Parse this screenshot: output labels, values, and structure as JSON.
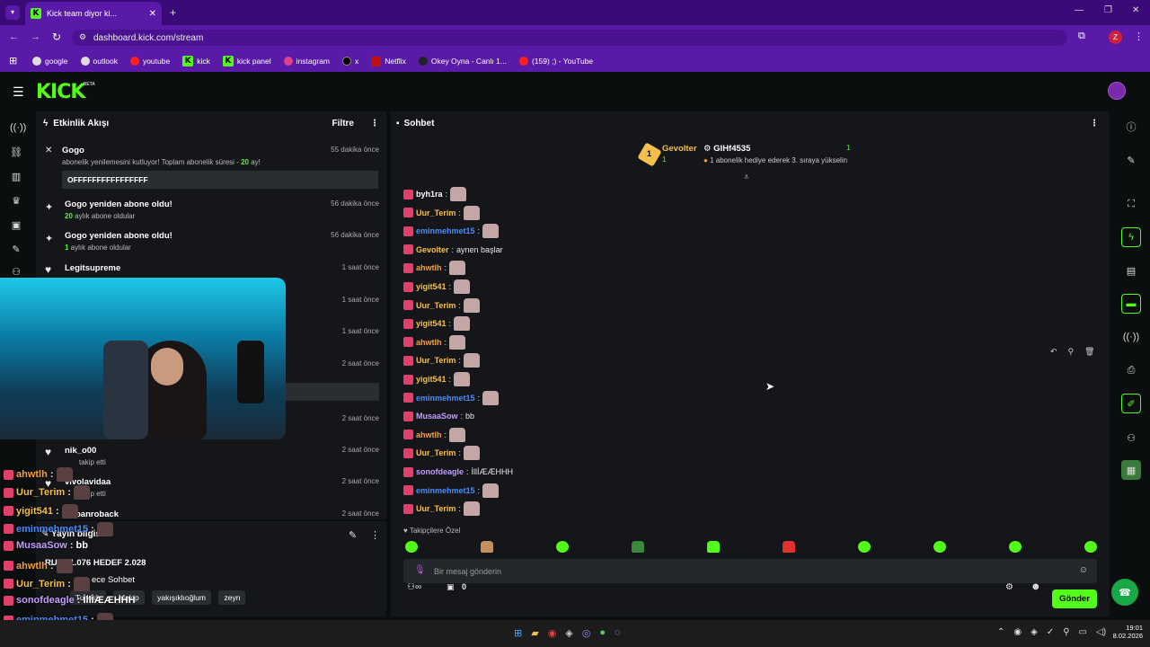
{
  "browser": {
    "tab_title": "Kick team diyor ki...",
    "url": "dashboard.kick.com/stream",
    "profile_initial": "Z",
    "bookmarks": [
      "google",
      "outlook",
      "youtube",
      "kick",
      "kick panel",
      "instagram",
      "x",
      "Netflix",
      "Okey Oyna - Canlı 1...",
      "(159) ;) - YouTube"
    ]
  },
  "header": {
    "logo": "KICK",
    "beta": "BETA"
  },
  "activity": {
    "title": "Etkinlik Akışı",
    "filter_label": "Filtre",
    "items": [
      {
        "title": "Gogo",
        "sub_pre": "abonelik yenilemesini kutluyor! Toplam abonelik süresi - ",
        "sub_num": "20",
        "sub_post": " ay!",
        "time": "55 dakika önce",
        "message": "OFFFFFFFFFFFFFFFF"
      },
      {
        "title": "Gogo yeniden abone oldu!",
        "sub_num": "20",
        "sub_post": " aylık abone oldular",
        "time": "56 dakika önce"
      },
      {
        "title": "Gogo yeniden abone oldu!",
        "sub_num": "1",
        "sub_post": " aylık abone oldular",
        "time": "56 dakika önce"
      },
      {
        "title": "Legitsupreme",
        "time": "1 saat önce"
      },
      {
        "time": "1 saat önce"
      },
      {
        "time": "1 saat önce"
      },
      {
        "time": "2 saat önce"
      },
      {
        "time": "2 saat önce"
      },
      {
        "title": "nik_o00",
        "sub_post": "takip etti",
        "time": "2 saat önce"
      },
      {
        "title": "vivolavidaa",
        "sub_post": "takip etti",
        "time": "2 saat önce"
      },
      {
        "title": "banroback",
        "time": "2 saat önce"
      }
    ]
  },
  "info_panel": {
    "title": "Yayın bilgisi",
    "stream_title": "RUM: 1.076 HEDEF 2.028",
    "mode": "ece Sohbet",
    "tags": [
      "Turkish",
      "Mekip",
      "yakışıklıoğlum",
      "zeyn"
    ]
  },
  "chat": {
    "title": "Sohbet",
    "pinned": {
      "left_user": "Gevolter",
      "left_count": "1",
      "right_user": "GIHf4535",
      "right_count": "1",
      "right_sub": "1 abonelik hediye ederek 3. sıraya yükselin"
    },
    "messages": [
      {
        "user": "byh1ra",
        "color": "#ffffff",
        "text": ""
      },
      {
        "user": "Uur_Terim",
        "color": "#f5c04a",
        "text": ""
      },
      {
        "user": "eminmehmet15",
        "color": "#4a8cff",
        "text": ""
      },
      {
        "user": "Gevolter",
        "color": "#f5c04a",
        "text": "aynen başlar"
      },
      {
        "user": "ahwtlh",
        "color": "#f5a040",
        "text": ""
      },
      {
        "user": "yigit541",
        "color": "#f5c04a",
        "text": ""
      },
      {
        "user": "Uur_Terim",
        "color": "#f5c04a",
        "text": ""
      },
      {
        "user": "yigit541",
        "color": "#f5c04a",
        "text": ""
      },
      {
        "user": "ahwtlh",
        "color": "#f5a040",
        "text": ""
      },
      {
        "user": "Uur_Terim",
        "color": "#f5c04a",
        "text": ""
      },
      {
        "user": "yigit541",
        "color": "#f5c04a",
        "text": ""
      },
      {
        "user": "eminmehmet15",
        "color": "#4a8cff",
        "text": ""
      },
      {
        "user": "MusaaSow",
        "color": "#c49cff",
        "text": "bb"
      },
      {
        "user": "ahwtlh",
        "color": "#f5a040",
        "text": ""
      },
      {
        "user": "Uur_Terim",
        "color": "#f5c04a",
        "text": ""
      },
      {
        "user": "sonofdeagle",
        "color": "#c49cff",
        "text": "İllİÆÆHHH"
      },
      {
        "user": "eminmehmet15",
        "color": "#4a8cff",
        "text": ""
      },
      {
        "user": "Uur_Terim",
        "color": "#f5c04a",
        "text": ""
      }
    ],
    "followers_only": "Takipçilere Özel",
    "input_placeholder": "Bir mesaj gönderin",
    "points": "0",
    "send_label": "Gönder"
  },
  "overlay_chat": [
    {
      "user": "ahwtlh",
      "color": "#f5a040",
      "text": ""
    },
    {
      "user": "Uur_Terim",
      "color": "#f5c04a",
      "text": ""
    },
    {
      "user": "yigit541",
      "color": "#f5c04a",
      "text": ""
    },
    {
      "user": "eminmehmet15",
      "color": "#4a8cff",
      "text": ""
    },
    {
      "user": "MusaaSow",
      "color": "#c49cff",
      "text": "bb"
    },
    {
      "user": "ahwtlh",
      "color": "#f5a040",
      "text": ""
    },
    {
      "user": "Uur_Terim",
      "color": "#f5c04a",
      "text": ""
    },
    {
      "user": "sonofdeagle",
      "color": "#c49cff",
      "text": "İllİÆÆHHH"
    },
    {
      "user": "eminmehmet15",
      "color": "#4a8cff",
      "text": ""
    },
    {
      "user": "Uur_Terim",
      "color": "#f5c04a",
      "text": ""
    }
  ],
  "taskbar": {
    "time": "19:01",
    "date": "8.02.2026"
  },
  "colors": {
    "accent": "#53fc18",
    "browser": "#5a1aa8",
    "panel": "#141619"
  }
}
